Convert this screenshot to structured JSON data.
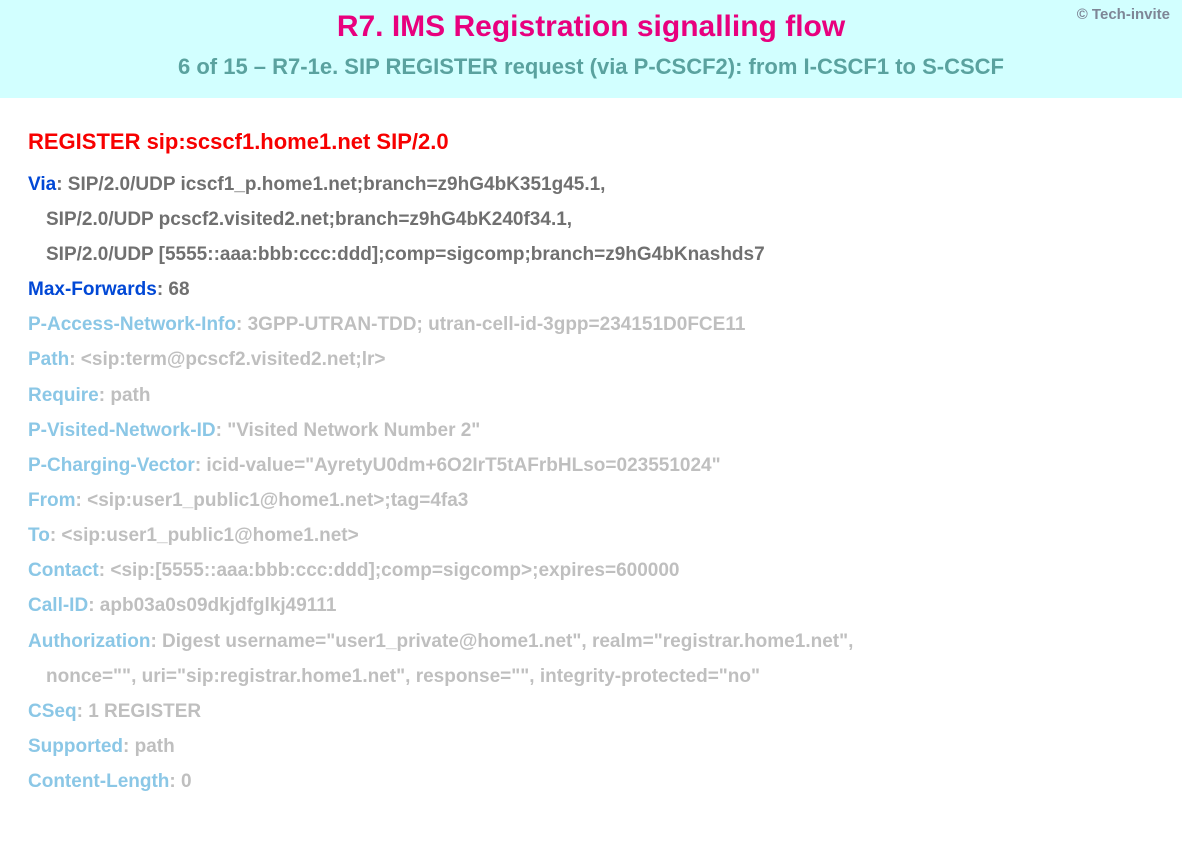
{
  "copyright": "© Tech-invite",
  "banner": {
    "title": "R7. IMS Registration signalling flow",
    "subtitle": "6 of 15 – R7-1e. SIP REGISTER request (via P-CSCF2): from I-CSCF1 to S-CSCF"
  },
  "request_line": "REGISTER sip:scscf1.home1.net SIP/2.0",
  "headers": [
    {
      "name": "Via",
      "value": "SIP/2.0/UDP icscf1_p.home1.net;branch=z9hG4bK351g45.1,",
      "cont": [
        "SIP/2.0/UDP pcscf2.visited2.net;branch=z9hG4bK240f34.1,",
        "SIP/2.0/UDP [5555::aaa:bbb:ccc:ddd];comp=sigcomp;branch=z9hG4bKnashds7"
      ],
      "faded": false
    },
    {
      "name": "Max-Forwards",
      "value": "68",
      "cont": [],
      "faded": false
    },
    {
      "name": "P-Access-Network-Info",
      "value": "3GPP-UTRAN-TDD; utran-cell-id-3gpp=234151D0FCE11",
      "cont": [],
      "faded": true
    },
    {
      "name": "Path",
      "value": "<sip:term@pcscf2.visited2.net;lr>",
      "cont": [],
      "faded": true
    },
    {
      "name": "Require",
      "value": "path",
      "cont": [],
      "faded": true
    },
    {
      "name": "P-Visited-Network-ID",
      "value": "\"Visited Network Number 2\"",
      "cont": [],
      "faded": true
    },
    {
      "name": "P-Charging-Vector",
      "value": "icid-value=\"AyretyU0dm+6O2IrT5tAFrbHLso=023551024\"",
      "cont": [],
      "faded": true
    },
    {
      "name": "From",
      "value": "<sip:user1_public1@home1.net>;tag=4fa3",
      "cont": [],
      "faded": true
    },
    {
      "name": "To",
      "value": "<sip:user1_public1@home1.net>",
      "cont": [],
      "faded": true
    },
    {
      "name": "Contact",
      "value": "<sip:[5555::aaa:bbb:ccc:ddd];comp=sigcomp>;expires=600000",
      "cont": [],
      "faded": true
    },
    {
      "name": "Call-ID",
      "value": "apb03a0s09dkjdfglkj49111",
      "cont": [],
      "faded": true
    },
    {
      "name": "Authorization",
      "value": "Digest username=\"user1_private@home1.net\", realm=\"registrar.home1.net\",",
      "cont": [
        "nonce=\"\", uri=\"sip:registrar.home1.net\", response=\"\", integrity-protected=\"no\""
      ],
      "faded": true
    },
    {
      "name": "CSeq",
      "value": "1 REGISTER",
      "cont": [],
      "faded": true
    },
    {
      "name": "Supported",
      "value": "path",
      "cont": [],
      "faded": true
    },
    {
      "name": "Content-Length",
      "value": "0",
      "cont": [],
      "faded": true
    }
  ]
}
